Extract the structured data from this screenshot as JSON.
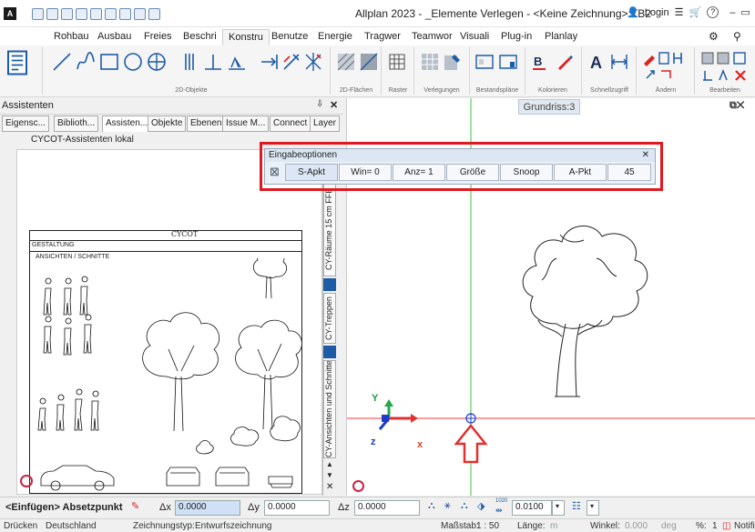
{
  "window": {
    "title": "Allplan 2023 - _Elemente Verlegen - <Keine Zeichnung>:TB2",
    "login_label": "Login",
    "controls": {
      "help": "?",
      "minimize": "–",
      "restore": "▭",
      "close": "✕"
    }
  },
  "ribbon": {
    "tabs": [
      "Rohbau",
      "Ausbau",
      "Freies",
      "Beschri",
      "Konstru",
      "Benutze",
      "Energie",
      "Tragwer",
      "Teamwor",
      "Visuali",
      "Plug-in",
      "Planlay"
    ],
    "active_tab": "Konstru",
    "groups": [
      "2D-Objekte",
      "2D-Flächen",
      "Raster",
      "Verlegungen",
      "Bestandspläne",
      "Kolorieren",
      "Schnellzugriff",
      "Ändern",
      "Bearbeiten"
    ]
  },
  "panel": {
    "title": "Assistenten",
    "pin": "📌",
    "close": "✕",
    "tabs": [
      "Eigensc...",
      "Biblioth...",
      "Assisten...",
      "Objekte",
      "Ebenen",
      "Issue M...",
      "Connect",
      "Layer"
    ],
    "active_tab": "Assisten...",
    "combo_value": "CYCOT-Assistenten lokal",
    "preview_header_left": "GESTALTUNG",
    "preview_subheader": "ANSICHTEN / SCHNITTE",
    "preview_logo": "CYCOT",
    "vertical_tabs": [
      "CY-Räume 15 cm FFB",
      "CY-Treppen",
      "CY-Ansichten und Schnitte"
    ]
  },
  "canvas": {
    "view_tab": "Grundriss:3",
    "axis_labels": {
      "x": "x",
      "y": "Y",
      "z": "z"
    }
  },
  "dialog": {
    "title": "Eingabeoptionen",
    "close": "✕",
    "buttons": [
      "S-Apkt",
      "Win= 0",
      "Anz= 1",
      "Größe",
      "Snoop",
      "A-Pkt",
      "45"
    ]
  },
  "inputbar": {
    "prompt": "<Einfügen> Absetzpunkt",
    "dx_label": "Δx",
    "dx_value": "0.0000",
    "dy_label": "Δy",
    "dy_value": "0.0000",
    "dz_label": "Δz",
    "dz_value": "0.0000",
    "scale_value": "0.0100",
    "scale_top": "1020"
  },
  "statusbar": {
    "mode": "Drücken",
    "country": "Deutschland",
    "drawing_type_label": "Zeichnungstyp:",
    "drawing_type": "Entwurfszeichnung",
    "scale_label": "Maßstab:",
    "scale": "1 : 50",
    "length_label": "Länge:",
    "length_unit": "m",
    "angle_label": "Winkel:",
    "angle": "0.000",
    "angle_unit": "deg",
    "percent_label": "%:",
    "percent": "1",
    "notifications": "Notifications"
  }
}
